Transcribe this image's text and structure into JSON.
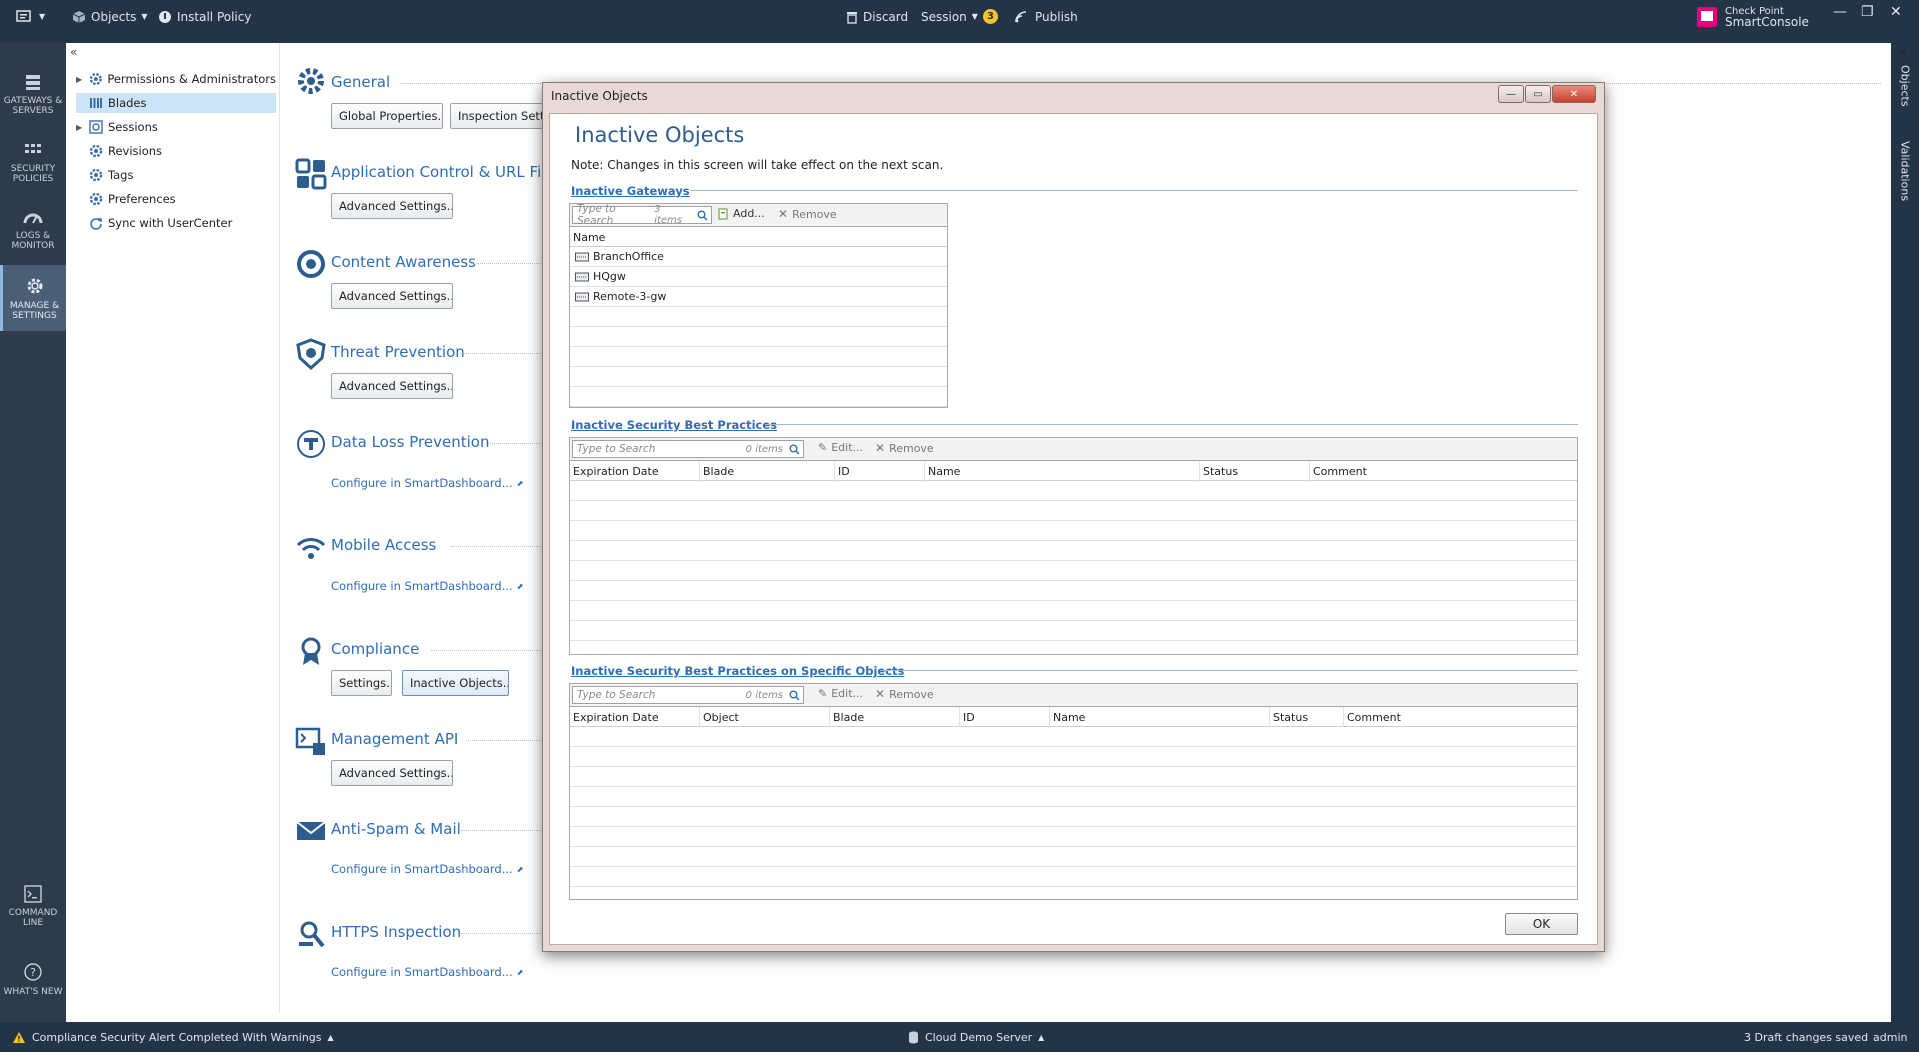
{
  "topbar": {
    "objects_label": "Objects",
    "install_policy_label": "Install Policy",
    "discard_label": "Discard",
    "session_label": "Session",
    "session_badge": "3",
    "publish_label": "Publish",
    "brand_line1": "Check Point",
    "brand_line2": "SmartConsole"
  },
  "leftnav": {
    "items": [
      {
        "label": "GATEWAYS & SERVERS",
        "icon": "gateways-icon"
      },
      {
        "label": "SECURITY POLICIES",
        "icon": "policies-icon"
      },
      {
        "label": "LOGS & MONITOR",
        "icon": "gauge-icon"
      },
      {
        "label": "MANAGE & SETTINGS",
        "icon": "gear-icon"
      }
    ],
    "bottom": [
      {
        "label": "COMMAND LINE",
        "icon": "terminal-icon"
      },
      {
        "label": "WHAT'S NEW",
        "icon": "help-icon"
      }
    ]
  },
  "tree": {
    "collapse": "«",
    "items": [
      {
        "label": "Permissions & Administrators",
        "expandable": true,
        "icon": "gear-icon"
      },
      {
        "label": "Blades",
        "expandable": false,
        "selected": true,
        "icon": "blades-icon"
      },
      {
        "label": "Sessions",
        "expandable": true,
        "icon": "sessions-icon"
      },
      {
        "label": "Revisions",
        "expandable": false,
        "icon": "gear-icon"
      },
      {
        "label": "Tags",
        "expandable": false,
        "icon": "gear-icon"
      },
      {
        "label": "Preferences",
        "expandable": false,
        "icon": "gear-icon"
      },
      {
        "label": "Sync with UserCenter",
        "expandable": false,
        "icon": "sync-icon"
      }
    ]
  },
  "blades": {
    "general": {
      "title": "General",
      "btn1": "Global Properties...",
      "btn2": "Inspection Settings..."
    },
    "app_control": {
      "title": "Application Control & URL Filtering",
      "btn1": "Advanced Settings..."
    },
    "content_awareness": {
      "title": "Content Awareness",
      "btn1": "Advanced Settings..."
    },
    "threat_prevention": {
      "title": "Threat Prevention",
      "btn1": "Advanced Settings..."
    },
    "dlp": {
      "title": "Data Loss Prevention",
      "link": "Configure in SmartDashboard..."
    },
    "mobile_access": {
      "title": "Mobile Access",
      "link": "Configure in SmartDashboard..."
    },
    "compliance": {
      "title": "Compliance",
      "btn1": "Settings...",
      "btn2": "Inactive Objects..."
    },
    "mgmt_api": {
      "title": "Management API",
      "btn1": "Advanced Settings..."
    },
    "antispam": {
      "title": "Anti-Spam & Mail",
      "link": "Configure in SmartDashboard..."
    },
    "https": {
      "title": "HTTPS Inspection",
      "link": "Configure in SmartDashboard..."
    }
  },
  "dialog": {
    "window_title": "Inactive Objects",
    "heading": "Inactive Objects",
    "note": "Note: Changes in this screen will take effect on the next scan.",
    "gateways": {
      "group_title": "Inactive Gateways",
      "search_placeholder": "Type to Search",
      "count": "3 items",
      "add_label": "Add...",
      "remove_label": "Remove",
      "columns": [
        "Name"
      ],
      "rows": [
        "BranchOffice",
        "HQgw",
        "Remote-3-gw"
      ]
    },
    "best_practices": {
      "group_title": "Inactive Security Best Practices",
      "search_placeholder": "Type to Search",
      "count": "0 items",
      "edit_label": "Edit...",
      "remove_label": "Remove",
      "columns": [
        "Expiration Date",
        "Blade",
        "ID",
        "Name",
        "Status",
        "Comment"
      ]
    },
    "specific_objects": {
      "group_title": "Inactive Security Best Practices on Specific Objects",
      "search_placeholder": "Type to Search",
      "count": "0 items",
      "edit_label": "Edit...",
      "remove_label": "Remove",
      "columns": [
        "Expiration Date",
        "Object",
        "Blade",
        "ID",
        "Name",
        "Status",
        "Comment"
      ]
    },
    "ok_label": "OK"
  },
  "rightstrip": {
    "tabs": [
      "Objects",
      "Validations"
    ]
  },
  "statusbar": {
    "alert": "Compliance Security Alert Completed With Warnings",
    "server": "Cloud Demo Server",
    "draft": "3 Draft changes saved",
    "user": "admin"
  },
  "colors": {
    "topbar": "#243447",
    "accent": "#2f6db5",
    "dialog_frame": "#e8d9d4"
  }
}
